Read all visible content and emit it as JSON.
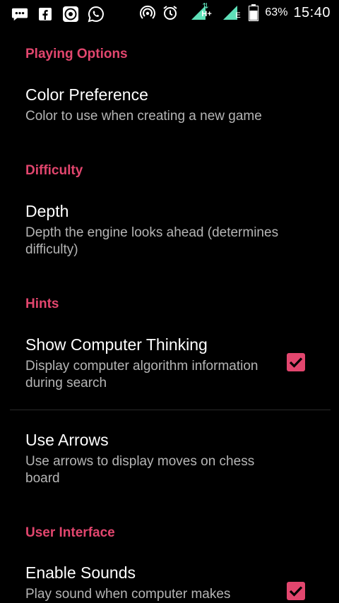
{
  "status_bar": {
    "battery_percent": "63%",
    "time": "15:40",
    "network_type": "H+",
    "network_type_2": "E",
    "icons": [
      "chat-icon",
      "facebook-icon",
      "app-badge-icon",
      "whatsapp-icon",
      "hotspot-icon",
      "alarm-icon",
      "signal-icon",
      "signal-icon-2",
      "battery-icon"
    ]
  },
  "accent_color": "#e2466e",
  "sections": {
    "playing_options": {
      "header": "Playing Options",
      "color_preference": {
        "title": "Color Preference",
        "summary": "Color to use when creating a new game"
      }
    },
    "difficulty": {
      "header": "Difficulty",
      "depth": {
        "title": "Depth",
        "summary": "Depth the engine looks ahead (determines difficulty)"
      }
    },
    "hints": {
      "header": "Hints",
      "show_thinking": {
        "title": "Show Computer Thinking",
        "summary": "Display computer algorithm information during search",
        "checked": true
      },
      "use_arrows": {
        "title": "Use Arrows",
        "summary": "Use arrows to display moves on chess board"
      }
    },
    "user_interface": {
      "header": "User Interface",
      "enable_sounds": {
        "title": "Enable Sounds",
        "summary": "Play sound when computer makes",
        "checked": true
      }
    }
  }
}
